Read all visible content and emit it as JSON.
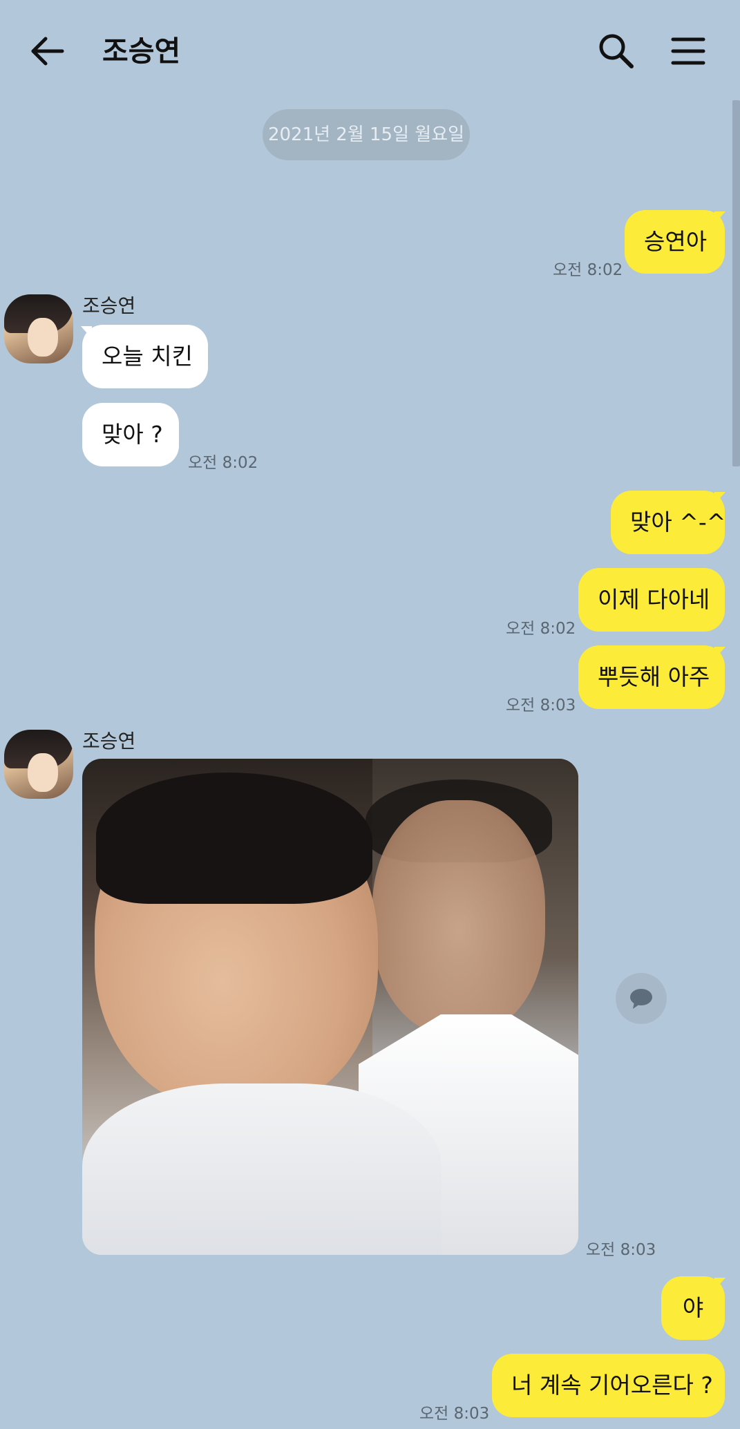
{
  "header": {
    "title": "조승연",
    "back_icon": "arrow-left-icon",
    "search_icon": "search-icon",
    "menu_icon": "hamburger-menu-icon"
  },
  "date_divider": "2021년 2월 15일 월요일",
  "colors": {
    "background": "#b2c7da",
    "my_bubble": "#fdeb3a",
    "their_bubble": "#ffffff"
  },
  "messages": [
    {
      "from": "me",
      "text": "승연아",
      "time": "오전 8:02"
    },
    {
      "from": "them",
      "sender": "조승연",
      "text": "오늘 치킨"
    },
    {
      "from": "them",
      "text": "맞아 ?",
      "time": "오전 8:02"
    },
    {
      "from": "me",
      "text": "맞아 ^-^"
    },
    {
      "from": "me",
      "text": "이제 다아네",
      "time": "오전 8:02"
    },
    {
      "from": "me",
      "text": "뿌듯해 아주",
      "time": "오전 8:03"
    },
    {
      "from": "them",
      "sender": "조승연",
      "type": "photo",
      "time": "오전 8:03"
    },
    {
      "from": "me",
      "text": "야"
    },
    {
      "from": "me",
      "text": "너 계속 기어오른다 ?",
      "time": "오전 8:03"
    }
  ]
}
